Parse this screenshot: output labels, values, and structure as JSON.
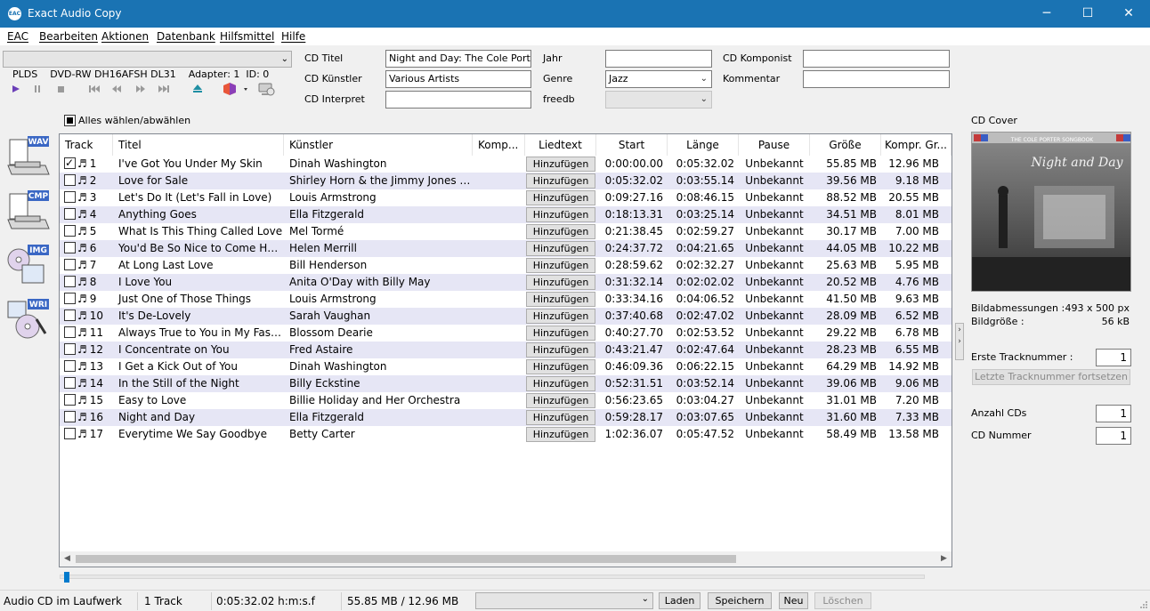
{
  "window": {
    "title": "Exact Audio Copy",
    "icon_text": "EAC",
    "controls": {
      "minimize": "─",
      "maximize": "☐",
      "close": "✕"
    }
  },
  "menu": [
    "EAC",
    "Bearbeiten",
    "Aktionen",
    "Datenbank",
    "Hilfsmittel",
    "Hilfe"
  ],
  "drive": {
    "selected": "PLDS    DVD-RW DH16AFSH DL31    Adapter: 1  ID: 0"
  },
  "toolbar": {
    "icons": [
      "play-icon",
      "pause-icon",
      "stop-icon",
      "first-track-icon",
      "previous-track-icon",
      "next-track-icon",
      "last-track-icon",
      "eject-icon",
      "metadata-plugin-icon",
      "freedb-server-icon"
    ]
  },
  "cd_info": {
    "title_label": "CD Titel",
    "title_value": "Night and Day: The Cole Porter Songbook",
    "artist_label": "CD Künstler",
    "artist_value": "Various Artists",
    "performer_label": "CD Interpret",
    "performer_value": "",
    "year_label": "Jahr",
    "year_value": "",
    "genre_label": "Genre",
    "genre_value": "Jazz",
    "freedb_label": "freedb",
    "freedb_value": "",
    "composer_label": "CD Komponist",
    "composer_value": "",
    "comment_label": "Kommentar",
    "comment_value": ""
  },
  "select_all_label": "Alles wählen/abwählen",
  "side_buttons": [
    "WAV",
    "CMP",
    "IMG",
    "WRI"
  ],
  "tracks": {
    "columns": [
      "Track",
      "Titel",
      "Künstler",
      "Komp...",
      "Liedtext",
      "Start",
      "Länge",
      "Pause",
      "Größe",
      "Kompr. Gr..."
    ],
    "add_label": "Hinzufügen",
    "rows": [
      {
        "no": "1",
        "checked": true,
        "title": "I've Got You Under My Skin",
        "artist": "Dinah Washington",
        "start": "0:00:00.00",
        "length": "0:05:32.02",
        "pause": "Unbekannt",
        "size": "55.85 MB",
        "csize": "12.96 MB"
      },
      {
        "no": "2",
        "checked": false,
        "title": "Love for Sale",
        "artist": "Shirley Horn & the Jimmy Jones Orchestra",
        "start": "0:05:32.02",
        "length": "0:03:55.14",
        "pause": "Unbekannt",
        "size": "39.56 MB",
        "csize": "9.18 MB"
      },
      {
        "no": "3",
        "checked": false,
        "title": "Let's Do It (Let's Fall in Love)",
        "artist": "Louis Armstrong",
        "start": "0:09:27.16",
        "length": "0:08:46.15",
        "pause": "Unbekannt",
        "size": "88.52 MB",
        "csize": "20.55 MB"
      },
      {
        "no": "4",
        "checked": false,
        "title": "Anything Goes",
        "artist": "Ella Fitzgerald",
        "start": "0:18:13.31",
        "length": "0:03:25.14",
        "pause": "Unbekannt",
        "size": "34.51 MB",
        "csize": "8.01 MB"
      },
      {
        "no": "5",
        "checked": false,
        "title": "What Is This Thing Called Love",
        "artist": "Mel Tormé",
        "start": "0:21:38.45",
        "length": "0:02:59.27",
        "pause": "Unbekannt",
        "size": "30.17 MB",
        "csize": "7.00 MB"
      },
      {
        "no": "6",
        "checked": false,
        "title": "You'd Be So Nice to Come Home To",
        "artist": "Helen Merrill",
        "start": "0:24:37.72",
        "length": "0:04:21.65",
        "pause": "Unbekannt",
        "size": "44.05 MB",
        "csize": "10.22 MB"
      },
      {
        "no": "7",
        "checked": false,
        "title": "At Long Last Love",
        "artist": "Bill Henderson",
        "start": "0:28:59.62",
        "length": "0:02:32.27",
        "pause": "Unbekannt",
        "size": "25.63 MB",
        "csize": "5.95 MB"
      },
      {
        "no": "8",
        "checked": false,
        "title": "I Love You",
        "artist": "Anita O'Day with Billy May",
        "start": "0:31:32.14",
        "length": "0:02:02.02",
        "pause": "Unbekannt",
        "size": "20.52 MB",
        "csize": "4.76 MB"
      },
      {
        "no": "9",
        "checked": false,
        "title": "Just One of Those Things",
        "artist": "Louis Armstrong",
        "start": "0:33:34.16",
        "length": "0:04:06.52",
        "pause": "Unbekannt",
        "size": "41.50 MB",
        "csize": "9.63 MB"
      },
      {
        "no": "10",
        "checked": false,
        "title": "It's De-Lovely",
        "artist": "Sarah Vaughan",
        "start": "0:37:40.68",
        "length": "0:02:47.02",
        "pause": "Unbekannt",
        "size": "28.09 MB",
        "csize": "6.52 MB"
      },
      {
        "no": "11",
        "checked": false,
        "title": "Always True to You in My Fashion",
        "artist": "Blossom Dearie",
        "start": "0:40:27.70",
        "length": "0:02:53.52",
        "pause": "Unbekannt",
        "size": "29.22 MB",
        "csize": "6.78 MB"
      },
      {
        "no": "12",
        "checked": false,
        "title": "I Concentrate on You",
        "artist": "Fred Astaire",
        "start": "0:43:21.47",
        "length": "0:02:47.64",
        "pause": "Unbekannt",
        "size": "28.23 MB",
        "csize": "6.55 MB"
      },
      {
        "no": "13",
        "checked": false,
        "title": "I Get a Kick Out of You",
        "artist": "Dinah Washington",
        "start": "0:46:09.36",
        "length": "0:06:22.15",
        "pause": "Unbekannt",
        "size": "64.29 MB",
        "csize": "14.92 MB"
      },
      {
        "no": "14",
        "checked": false,
        "title": "In the Still of the Night",
        "artist": "Billy Eckstine",
        "start": "0:52:31.51",
        "length": "0:03:52.14",
        "pause": "Unbekannt",
        "size": "39.06 MB",
        "csize": "9.06 MB"
      },
      {
        "no": "15",
        "checked": false,
        "title": "Easy to Love",
        "artist": "Billie Holiday and Her Orchestra",
        "start": "0:56:23.65",
        "length": "0:03:04.27",
        "pause": "Unbekannt",
        "size": "31.01 MB",
        "csize": "7.20 MB"
      },
      {
        "no": "16",
        "checked": false,
        "title": "Night and Day",
        "artist": "Ella Fitzgerald",
        "start": "0:59:28.17",
        "length": "0:03:07.65",
        "pause": "Unbekannt",
        "size": "31.60 MB",
        "csize": "7.33 MB"
      },
      {
        "no": "17",
        "checked": false,
        "title": "Everytime We Say Goodbye",
        "artist": "Betty Carter",
        "start": "1:02:36.07",
        "length": "0:05:47.52",
        "pause": "Unbekannt",
        "size": "58.49 MB",
        "csize": "13.58 MB"
      }
    ]
  },
  "right_panel": {
    "cover_label": "CD Cover",
    "cover_art_header": "THE COLE PORTER SONGBOOK",
    "cover_art_title": "Night and Day",
    "dims_label": "Bildabmessungen :",
    "dims_value": "493 x 500 px",
    "size_label": "Bildgröße :",
    "size_value": "56 kB",
    "first_track_label": "Erste Tracknummer :",
    "first_track_value": "1",
    "continue_label": "Letzte Tracknummer fortsetzen",
    "num_cds_label": "Anzahl CDs",
    "num_cds_value": "1",
    "cd_number_label": "CD Nummer",
    "cd_number_value": "1"
  },
  "status": {
    "disc": "Audio CD im Laufwerk",
    "tracks": "1 Track",
    "time": "0:05:32.02 h:m:s.f",
    "size": "55.85 MB /  12.96 MB",
    "buttons": {
      "load": "Laden",
      "save": "Speichern",
      "new": "Neu",
      "delete": "Löschen"
    }
  },
  "colors": {
    "titlebar": "#1a73b3",
    "row_alt": "#e6e6f5",
    "accent": "#007acc"
  }
}
